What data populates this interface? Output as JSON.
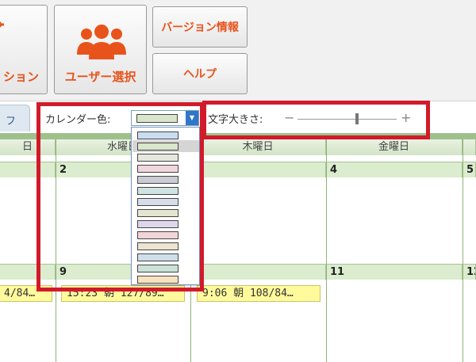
{
  "ribbon": {
    "options_label": "ション",
    "user_select_label": "ユーザー選択",
    "version_info_label": "バージョン情報",
    "help_label": "ヘルプ"
  },
  "toolbar": {
    "tab_label": "フ",
    "calendar_color_label": "カレンダー色:",
    "font_size_label": "文字大きさ:",
    "slider_minus": "−",
    "slider_plus": "+",
    "font_size_level": 0.6,
    "selected_color": "#d8e6cc"
  },
  "calendar": {
    "headers": [
      "日",
      "水曜日",
      "木曜日",
      "金曜日",
      ""
    ],
    "week1_days": [
      "",
      "2",
      "",
      "4",
      "5"
    ],
    "week2_days": [
      "",
      "9",
      "0",
      "11",
      "12"
    ],
    "events": [
      "4/84…",
      "15:23 朝 127/89…",
      "9:06 朝 108/84…"
    ]
  },
  "color_options": [
    "#c9ddf2",
    "#d8e6cc",
    "#e7e8dd",
    "#f1d6dc",
    "#c9ccd3",
    "#cde4e2",
    "#d7ddeb",
    "#e5e6d0",
    "#ddd6ec",
    "#f1d5d8",
    "#ece3d1",
    "#cfdfec",
    "#cbe1d9",
    "#f8e3bf"
  ],
  "colors": {
    "accent_orange": "#e8531b",
    "highlight_red": "#d11a2a",
    "calendar_green": "#9ec18c",
    "event_yellow": "#fffa9c",
    "combo_blue": "#2f77c6"
  }
}
